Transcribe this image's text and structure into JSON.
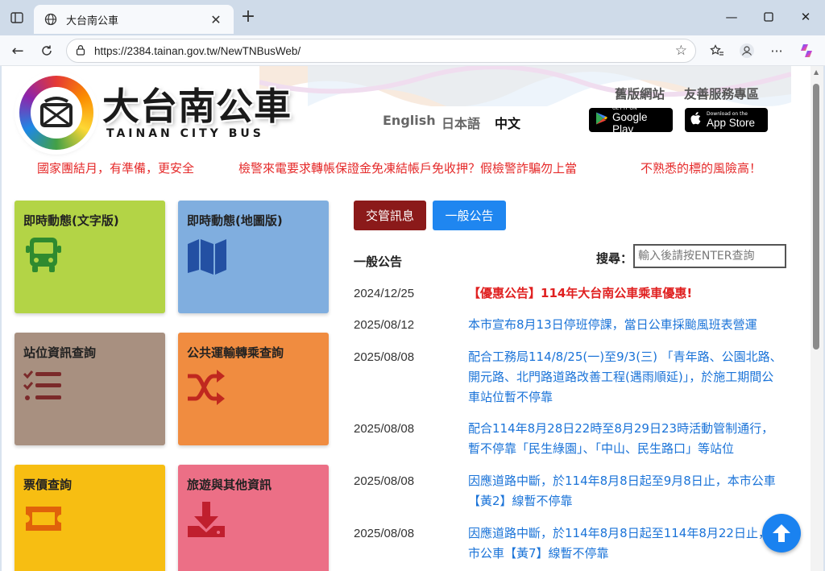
{
  "browser": {
    "tab_title": "大台南公車",
    "url": "https://2384.tainan.gov.tw/NewTNBusWeb/"
  },
  "header": {
    "logo_title": "大台南公車",
    "logo_subtitle": "TAINAN CITY BUS",
    "languages": [
      "English",
      "日本語",
      "中文"
    ],
    "active_language": "中文",
    "links": {
      "old_site": "舊版網站",
      "friendly": "友善服務專區"
    },
    "google_play": {
      "small": "GET IT ON",
      "big": "Google Play"
    },
    "app_store": {
      "small": "Download on the",
      "big": "App Store"
    }
  },
  "ticker": [
    "國家團結月，有準備，更安全",
    "檢警來電要求轉帳保證金免凍結帳戶免收押？假檢警詐騙勿上當",
    "不熟悉的標的風險高！"
  ],
  "tiles": [
    {
      "label": "即時動態(文字版)",
      "color": "#b3d446"
    },
    {
      "label": "即時動態(地圖版)",
      "color": "#80aedf"
    },
    {
      "label": "站位資訊查詢",
      "color": "#a89080"
    },
    {
      "label": "公共運輸轉乘查詢",
      "color": "#f08c40"
    },
    {
      "label": "票價查詢",
      "color": "#f7be12"
    },
    {
      "label": "旅遊與其他資訊",
      "color": "#ec6f86"
    }
  ],
  "news_tabs": {
    "traffic": "交管訊息",
    "general": "一般公告"
  },
  "section_title": "一般公告",
  "search": {
    "label": "搜尋：",
    "placeholder": "輸入後請按ENTER查詢"
  },
  "news": [
    {
      "date": "2024/12/25",
      "title": "【優惠公告】114年大台南公車乘車優惠!"
    },
    {
      "date": "2025/08/12",
      "title": "本市宣布8月13日停班停課，當日公車採颱風班表營運"
    },
    {
      "date": "2025/08/08",
      "title": "配合工務局114/8/25(一)至9/3(三) 「青年路、公園北路、開元路、北門路道路改善工程(遇雨順延)」，於施工期間公車站位暫不停靠"
    },
    {
      "date": "2025/08/08",
      "title": "配合114年8月28日22時至8月29日23時活動管制通行，暫不停靠「民生綠園」、「中山、民生路口」等站位"
    },
    {
      "date": "2025/08/08",
      "title": "因應道路中斷，於114年8月8日起至9月8日止，本市公車【黃2】線暫不停靠"
    },
    {
      "date": "2025/08/08",
      "title": "因應道路中斷，於114年8月8日起至114年8月22日止，本市公車【黃7】線暫不停靠"
    }
  ],
  "colors": {
    "traffic_tab": "#8b1a1a",
    "general_tab": "#1f86f0",
    "link": "#1a73d8",
    "hot": "#e02020"
  }
}
